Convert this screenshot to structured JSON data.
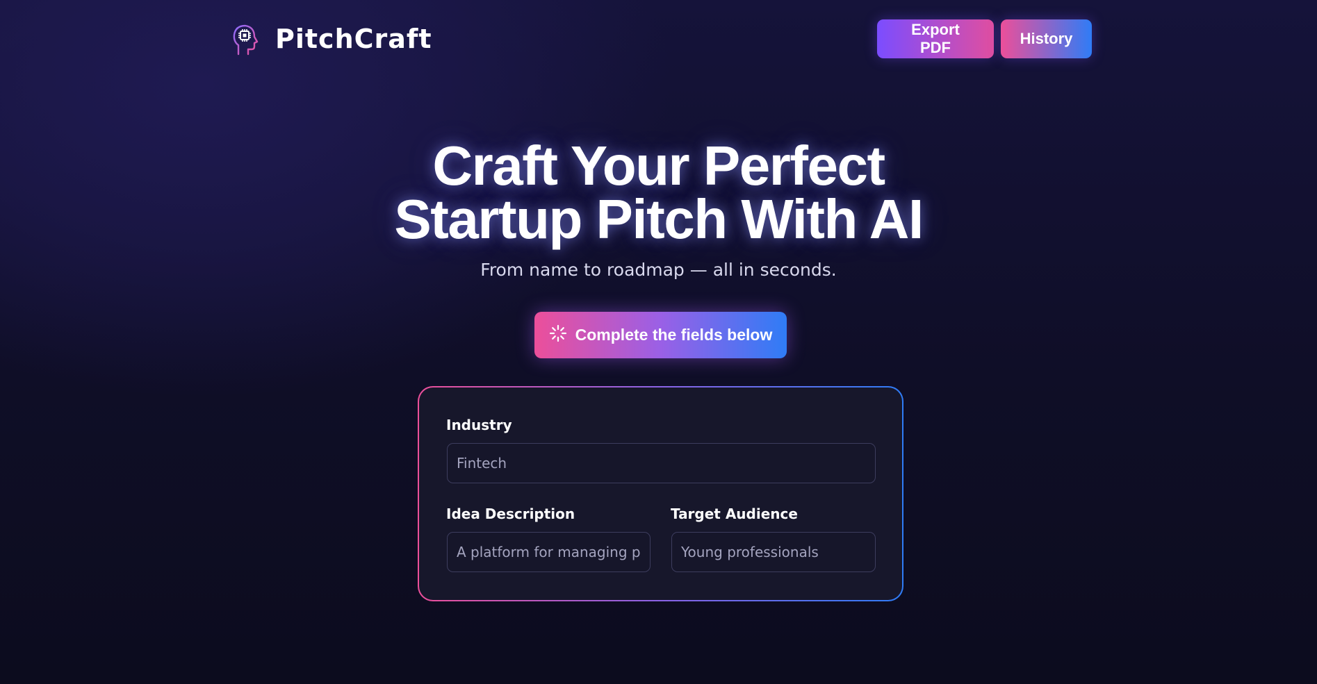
{
  "app": {
    "name": "PitchCraft"
  },
  "nav": {
    "export_label": "Export PDF",
    "history_label": "History"
  },
  "hero": {
    "title_line1": "Craft Your Perfect",
    "title_line2": "Startup Pitch With AI",
    "subtitle": "From name to roadmap — all in seconds."
  },
  "cta": {
    "label": "Complete the fields below",
    "icon": "loading-spinner-icon"
  },
  "form": {
    "industry": {
      "label": "Industry",
      "placeholder": "Fintech"
    },
    "idea": {
      "label": "Idea Description",
      "placeholder": "A platform for managing per"
    },
    "audience": {
      "label": "Target Audience",
      "placeholder": "Young professionals"
    }
  },
  "colors": {
    "accent_pink": "#ec4f9a",
    "accent_purple": "#7b4dff",
    "accent_blue": "#2f7cf6",
    "background": "#0f0e27",
    "card_background": "#17172b"
  }
}
